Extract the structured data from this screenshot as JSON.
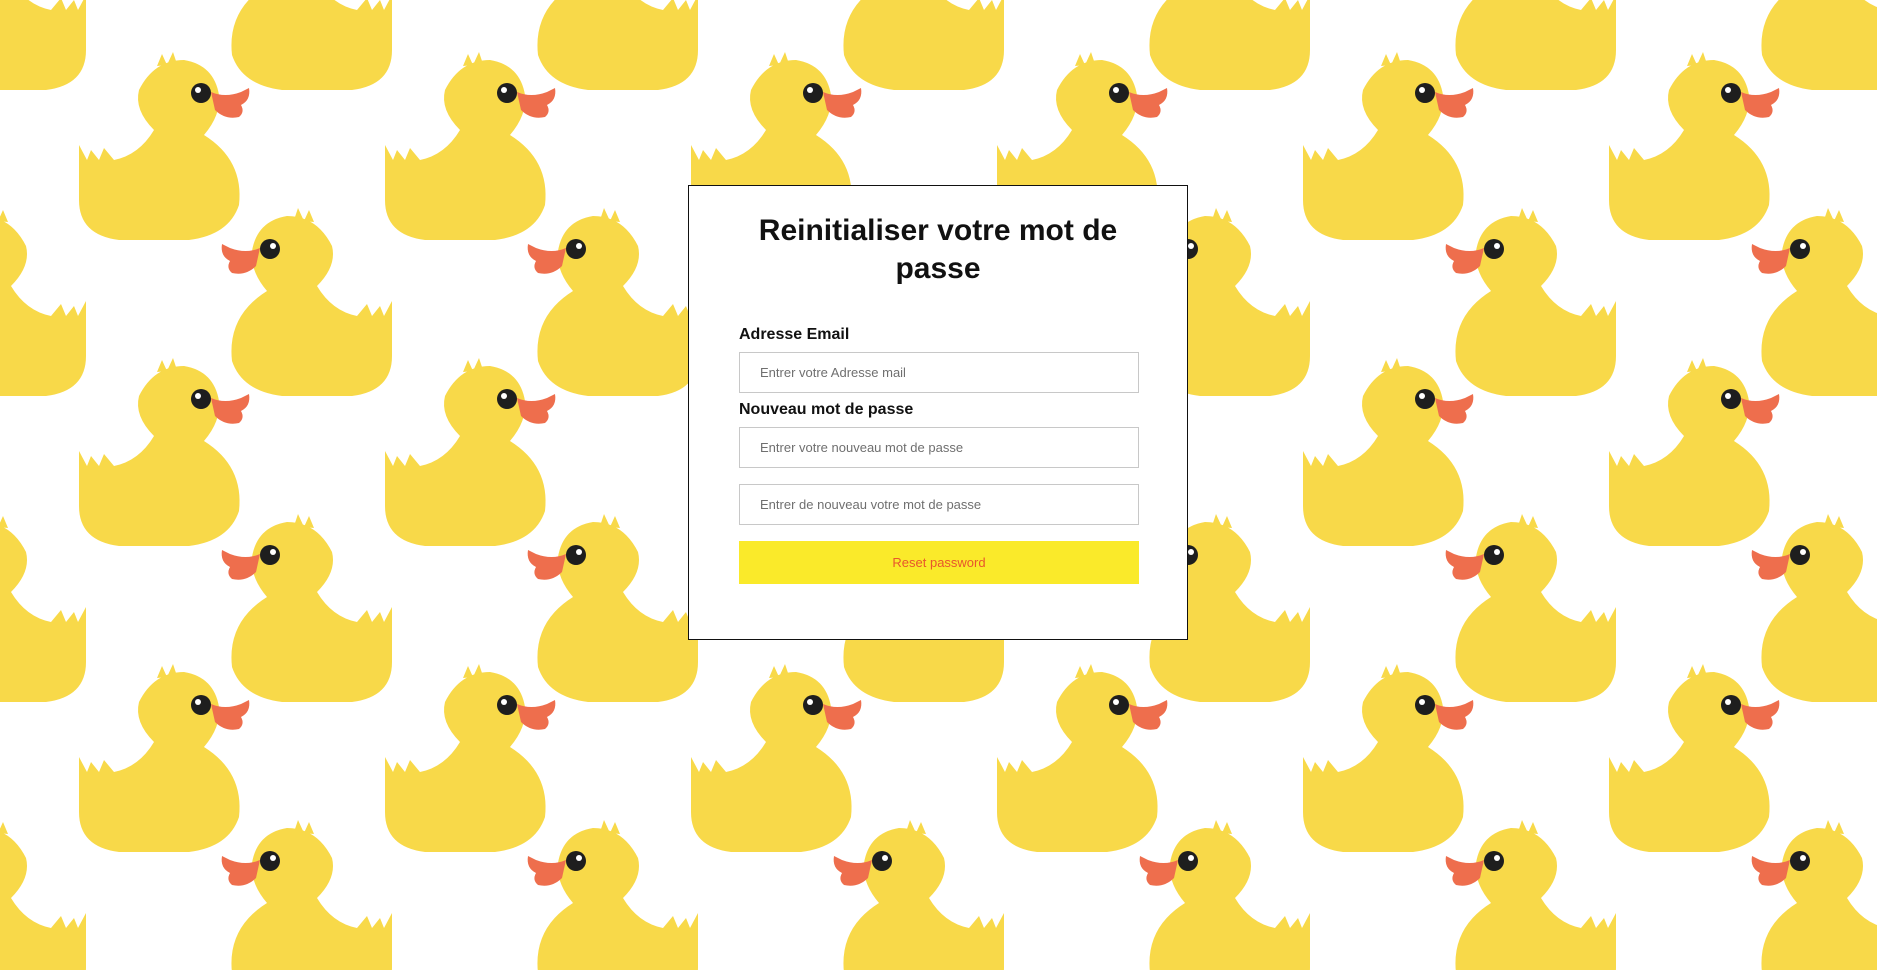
{
  "colors": {
    "duck_body": "#F8D949",
    "duck_beak": "#EE6E4D",
    "duck_eye": "#1E1E1E",
    "button_bg": "#FAEA2A",
    "button_text": "#E8562C"
  },
  "form": {
    "title": "Reinitialiser votre mot de passe",
    "email_label": "Adresse Email",
    "email_placeholder": "Entrer votre Adresse mail",
    "password_label": "Nouveau mot de passe",
    "password_placeholder": "Entrer votre nouveau mot de passe",
    "confirm_placeholder": "Entrer de nouveau votre mot de passe",
    "submit_label": "Reset password"
  }
}
